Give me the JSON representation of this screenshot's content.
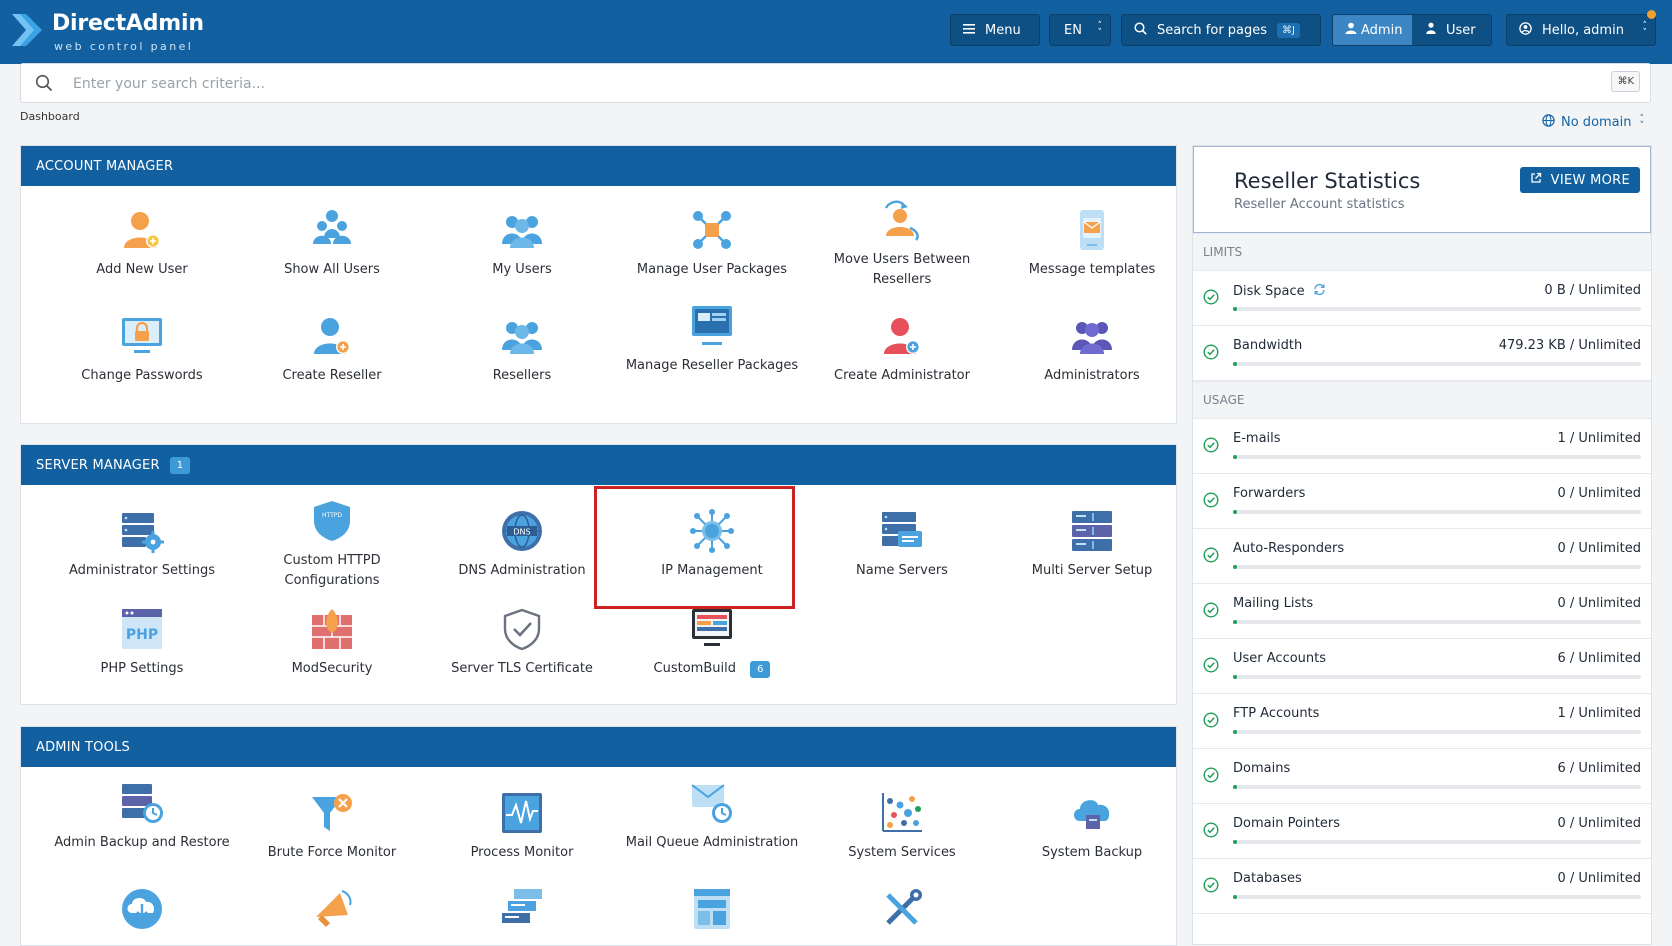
{
  "app": {
    "logo_title": "DirectAdmin",
    "logo_subtitle": "web control panel"
  },
  "topbar": {
    "menu_label": "Menu",
    "lang_label": "EN",
    "search_label": "Search for pages",
    "search_shortcut": "⌘J",
    "mode_admin": "Admin",
    "mode_user": "User",
    "greeting": "Hello, admin"
  },
  "search": {
    "placeholder": "Enter your search criteria...",
    "shortcut": "⌘K"
  },
  "breadcrumb": "Dashboard",
  "domain_selector": "No domain",
  "account_manager": {
    "title": "ACCOUNT MANAGER",
    "items": [
      {
        "label": "Add New User",
        "icon": "add-user-icon"
      },
      {
        "label": "Show All Users",
        "icon": "users-icon"
      },
      {
        "label": "My Users",
        "icon": "my-users-icon"
      },
      {
        "label": "Manage User Packages",
        "icon": "packages-network-icon"
      },
      {
        "label": "Move Users Between Resellers",
        "icon": "move-users-icon"
      },
      {
        "label": "Message templates",
        "icon": "message-template-icon"
      },
      {
        "label": "Change Passwords",
        "icon": "lock-monitor-icon"
      },
      {
        "label": "Create Reseller",
        "icon": "create-reseller-icon"
      },
      {
        "label": "Resellers",
        "icon": "resellers-icon"
      },
      {
        "label": "Manage Reseller Packages",
        "icon": "reseller-packages-icon"
      },
      {
        "label": "Create Administrator",
        "icon": "create-admin-icon"
      },
      {
        "label": "Administrators",
        "icon": "administrators-icon"
      }
    ]
  },
  "server_manager": {
    "title": "SERVER MANAGER",
    "badge": "1",
    "items": [
      {
        "label": "Administrator Settings",
        "icon": "admin-settings-icon"
      },
      {
        "label": "Custom HTTPD Configurations",
        "icon": "httpd-shield-icon"
      },
      {
        "label": "DNS Administration",
        "icon": "dns-globe-icon"
      },
      {
        "label": "IP Management",
        "icon": "ip-network-icon"
      },
      {
        "label": "Name Servers",
        "icon": "name-servers-icon"
      },
      {
        "label": "Multi Server Setup",
        "icon": "multi-server-icon"
      },
      {
        "label": "PHP Settings",
        "icon": "php-icon"
      },
      {
        "label": "ModSecurity",
        "icon": "firewall-icon"
      },
      {
        "label": "Server TLS Certificate",
        "icon": "shield-check-icon"
      },
      {
        "label": "CustomBuild",
        "icon": "custombuild-icon",
        "badge": "6"
      }
    ]
  },
  "admin_tools": {
    "title": "ADMIN TOOLS",
    "items": [
      {
        "label": "Admin Backup and Restore",
        "icon": "backup-restore-icon"
      },
      {
        "label": "Brute Force Monitor",
        "icon": "funnel-block-icon"
      },
      {
        "label": "Process Monitor",
        "icon": "pulse-monitor-icon"
      },
      {
        "label": "Mail Queue Administration",
        "icon": "mail-queue-icon"
      },
      {
        "label": "System Services",
        "icon": "system-services-icon"
      },
      {
        "label": "System Backup",
        "icon": "cloud-backup-icon"
      }
    ]
  },
  "stats": {
    "title": "Reseller Statistics",
    "subtitle": "Reseller Account statistics",
    "view_more": "VIEW MORE",
    "limits_label": "LIMITS",
    "usage_label": "USAGE",
    "limits": [
      {
        "name": "Disk Space",
        "value": "0 B / Unlimited"
      },
      {
        "name": "Bandwidth",
        "value": "479.23 KB / Unlimited"
      }
    ],
    "usage": [
      {
        "name": "E-mails",
        "value": "1 / Unlimited"
      },
      {
        "name": "Forwarders",
        "value": "0 / Unlimited"
      },
      {
        "name": "Auto-Responders",
        "value": "0 / Unlimited"
      },
      {
        "name": "Mailing Lists",
        "value": "0 / Unlimited"
      },
      {
        "name": "User Accounts",
        "value": "6 / Unlimited"
      },
      {
        "name": "FTP Accounts",
        "value": "1 / Unlimited"
      },
      {
        "name": "Domains",
        "value": "6 / Unlimited"
      },
      {
        "name": "Domain Pointers",
        "value": "0 / Unlimited"
      },
      {
        "name": "Databases",
        "value": "0 / Unlimited"
      }
    ]
  },
  "colors": {
    "brand": "#12609f",
    "accent": "#3c9ad8",
    "icon_blue": "#4aa3df",
    "icon_orange": "#f5a04a",
    "progress": "#1fa05a",
    "highlight": "#cc2222"
  }
}
